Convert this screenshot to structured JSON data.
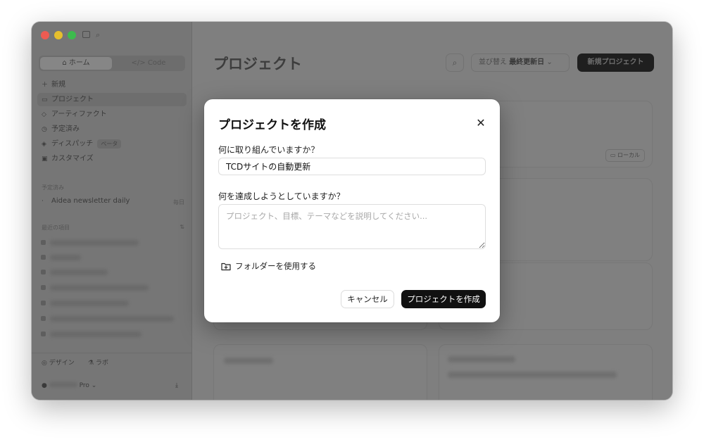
{
  "sidebar": {
    "tabs": [
      {
        "icon": "home-icon",
        "label": "ホーム"
      },
      {
        "icon": "code-icon",
        "label": "Code"
      }
    ],
    "items": [
      {
        "label": "新規"
      },
      {
        "label": "プロジェクト"
      },
      {
        "label": "アーティファクト"
      },
      {
        "label": "予定済み"
      },
      {
        "label": "ディスパッチ",
        "badge": "ベータ"
      },
      {
        "label": "カスタマイズ"
      }
    ],
    "scheduled_heading": "予定済み",
    "scheduled_item": {
      "label": "Aidea newsletter daily",
      "frequency": "毎日"
    },
    "recent_heading": "最近の項目",
    "footer": {
      "design_label": "デザイン",
      "extra_label": "ラボ",
      "plan": "Pro"
    }
  },
  "main": {
    "title": "プロジェクト",
    "sort": {
      "prefix": "並び替え",
      "value": "最終更新日"
    },
    "new_project_label": "新規プロジェクト",
    "local_badge": "ローカル"
  },
  "dialog": {
    "title": "プロジェクトを作成",
    "question1": "何に取り組んでいますか？",
    "input_value": "TCDサイトの自動更新",
    "question2": "何を達成しようとしていますか？",
    "textarea_placeholder": "プロジェクト、目標、テーマなどを説明してください...",
    "folder_label": "フォルダーを使用する",
    "cancel_label": "キャンセル",
    "create_label": "プロジェクトを作成"
  }
}
